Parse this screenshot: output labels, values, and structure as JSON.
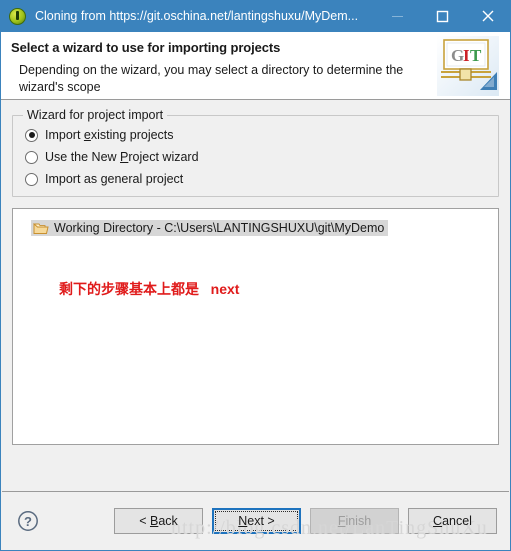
{
  "window": {
    "title": "Cloning from https://git.oschina.net/lantingshuxu/MyDem...",
    "app_icon": "eclipse-icon",
    "controls": {
      "minimize": "minimize-icon",
      "maximize": "maximize-icon",
      "close": "close-icon"
    },
    "accent_color": "#3b83bd"
  },
  "header": {
    "title": "Select a wizard to use for importing projects",
    "description": "Depending on the wizard, you may select a directory to determine the wizard's scope",
    "logo": {
      "letters": [
        "G",
        "I",
        "T"
      ],
      "colors": [
        "#8c8c8c",
        "#cc2229",
        "#3d9a4e"
      ]
    }
  },
  "group": {
    "legend": "Wizard for project import",
    "options": [
      {
        "label_before": "Import ",
        "mnemonic": "e",
        "label_after": "xisting projects",
        "checked": true
      },
      {
        "label_before": "Use the New ",
        "mnemonic": "P",
        "label_after": "roject wizard",
        "checked": false
      },
      {
        "label_before": "Import as ",
        "mnemonic": "g",
        "label_after": "eneral project",
        "checked": false
      }
    ]
  },
  "tree": {
    "item_label": "Working Directory - C:\\Users\\LANTINGSHUXU\\git\\MyDemo",
    "item_icon": "folder-open-icon",
    "selected": true,
    "annotation": {
      "text": "剩下的步骤基本上都是   next",
      "color": "#e01b1b"
    }
  },
  "footer": {
    "help_icon": "help-question-icon",
    "buttons": [
      {
        "label_before": "< ",
        "mnemonic": "B",
        "label_after": "ack",
        "state": "normal"
      },
      {
        "label_before": "",
        "mnemonic": "N",
        "label_after": "ext >",
        "state": "focused"
      },
      {
        "label_before": "",
        "mnemonic": "F",
        "label_after": "inish",
        "state": "disabled"
      },
      {
        "label_before": "",
        "mnemonic": "C",
        "label_after": "ancel",
        "state": "normal"
      }
    ]
  },
  "watermark": {
    "text": "http://blog.csdn.net/LanTingShuXu"
  }
}
